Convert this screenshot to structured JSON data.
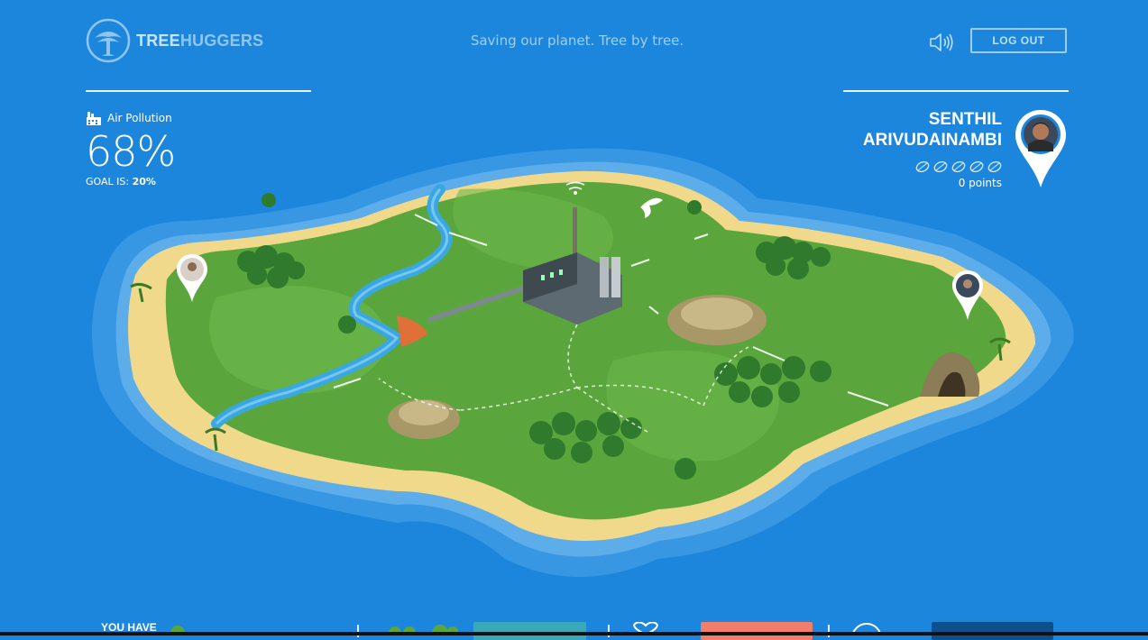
{
  "header": {
    "logo_text_a": "TREE",
    "logo_text_b": "HUGGERS",
    "tagline": "Saving our planet. Tree by tree.",
    "logout_label": "LOG OUT",
    "sound_icon": "speaker-icon"
  },
  "stats": {
    "label": "Air Pollution",
    "icon": "factory-icon",
    "value": "68%",
    "goal_prefix": "GOAL IS: ",
    "goal_value": "20%"
  },
  "user": {
    "first_name": "SENTHIL",
    "last_name": "ARIVUDAINAMBI",
    "points": "0 points",
    "leaves_total": 5,
    "leaves_earned": 0
  },
  "bottom_bar": {
    "you_have": "YOU HAVE"
  },
  "colors": {
    "background": "#1c86dd",
    "sand": "#f1d98c",
    "grass": "#5aa63c",
    "shallow_water": "#4ea6e8",
    "logout_border": "#9ecdf1"
  }
}
